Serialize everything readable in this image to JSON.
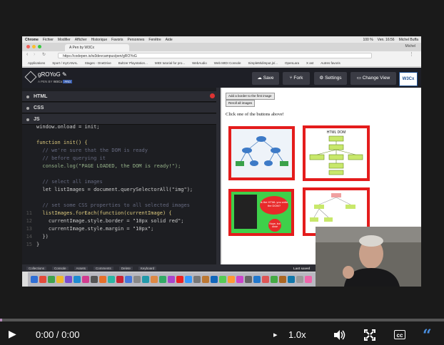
{
  "mac_menubar": {
    "apple": "",
    "app": "Chrome",
    "items": [
      "Fichier",
      "Modifier",
      "Afficher",
      "Historique",
      "Favoris",
      "Personnes",
      "Fenêtre",
      "Aide"
    ],
    "battery": "100 %",
    "clock": "Ven. 16:56",
    "user": "Michel Buffa"
  },
  "browser": {
    "tab_title": "A Pen by W3Cx",
    "profile": "Michel",
    "url": "https://codepen.io/w3devcampus/pen/gROYoG",
    "bookmarks": [
      "Applications",
      "Sport / myCANAL",
      "Stages - OneDrive",
      "Bultzer Playstation...",
      "MIDI tutorial for pro...",
      "WebAudio",
      "Web MIDI Console",
      "SimpleMidiInput.js/...",
      "OpenLara",
      "X ast",
      "Autres favoris"
    ]
  },
  "codepen": {
    "pen_title": "gROYoG",
    "by_prefix": "A PEN BY",
    "author": "W3Cx",
    "pro_badge": "PRO",
    "buttons": {
      "save": "Save",
      "fork": "Fork",
      "settings": "Settings",
      "change_view": "Change View"
    },
    "w3c_logo": "W3Cx",
    "panels": {
      "html": "HTML",
      "css": "CSS",
      "js": "JS"
    },
    "footer": [
      "Collections",
      "Console",
      "Assets",
      "Comments",
      "Delete",
      "Keyboard"
    ],
    "last_saved": "Last saved"
  },
  "code_lines": [
    {
      "n": "",
      "t": "window.onload = init;",
      "cls": ""
    },
    {
      "n": "",
      "t": "",
      "cls": ""
    },
    {
      "n": "",
      "t": "function init() {",
      "cls": "kw"
    },
    {
      "n": "",
      "t": "  // we're sure that the DOM is ready",
      "cls": "cm"
    },
    {
      "n": "",
      "t": "  // before querying it",
      "cls": "cm"
    },
    {
      "n": "",
      "t": "  console.log(\"PAGE LOADED, the DOM is ready!\");",
      "cls": "str"
    },
    {
      "n": "",
      "t": "",
      "cls": ""
    },
    {
      "n": "",
      "t": "  // select all images",
      "cls": "cm"
    },
    {
      "n": "",
      "t": "  let listImages = document.querySelectorAll(\"img\");",
      "cls": ""
    },
    {
      "n": "",
      "t": "",
      "cls": ""
    },
    {
      "n": "",
      "t": "  // set some CSS properties to all selected images",
      "cls": "cm"
    },
    {
      "n": "11",
      "t": "  listImages.forEach(function(currentImage) {",
      "cls": "fn"
    },
    {
      "n": "12",
      "t": "    currentImage.style.border = \"10px solid red\";",
      "cls": ""
    },
    {
      "n": "13",
      "t": "    currentImage.style.margin = \"10px\";",
      "cls": ""
    },
    {
      "n": "14",
      "t": "  })",
      "cls": ""
    },
    {
      "n": "15",
      "t": "}",
      "cls": ""
    }
  ],
  "preview": {
    "btn_add_border": "Add a border to the first image",
    "btn_reroll": "Reroll all images",
    "instruction": "Click one of the buttons above!",
    "thumb_dom_title": "HTML DOM",
    "thumb_speech": "Is the HTML you write the DOM?",
    "thumb_bubble": "Nope, but close"
  },
  "player": {
    "time": "0:00 / 0:00",
    "speed": "1.0x",
    "progress_fraction": 0.005,
    "accent_color": "#b38ab8"
  }
}
